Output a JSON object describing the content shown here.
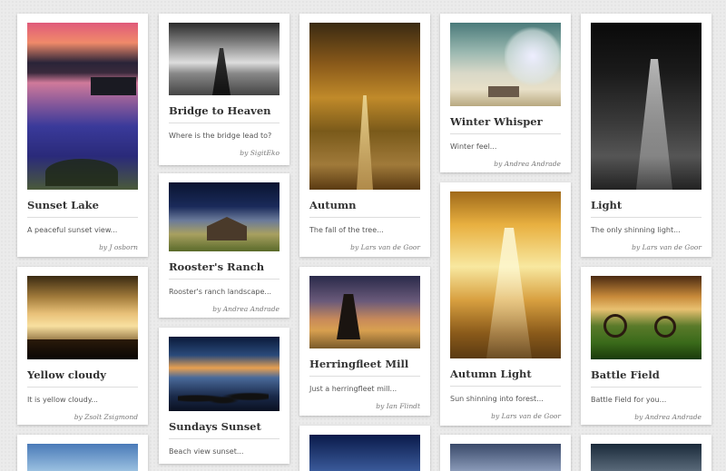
{
  "cards": [
    {
      "title": "Sunset Lake",
      "desc": "A peaceful sunset view...",
      "author": "by J osborn"
    },
    {
      "title": "Bridge to Heaven",
      "desc": "Where is the bridge lead to?",
      "author": "by SigitEko"
    },
    {
      "title": "Autumn",
      "desc": "The fall of the tree...",
      "author": "by Lars van de Goor"
    },
    {
      "title": "Winter Whisper",
      "desc": "Winter feel...",
      "author": "by Andrea Andrade"
    },
    {
      "title": "Light",
      "desc": "The only shinning light...",
      "author": "by Lars van de Goor"
    },
    {
      "title": "Rooster's Ranch",
      "desc": "Rooster's ranch landscape...",
      "author": "by Andrea Andrade"
    },
    {
      "title": "Yellow cloudy",
      "desc": "It is yellow cloudy...",
      "author": "by Zsolt Zsigmond"
    },
    {
      "title": "Herringfleet Mill",
      "desc": "Just a herringfleet mill...",
      "author": "by Ian Flindt"
    },
    {
      "title": "Autumn Light",
      "desc": "Sun shinning into forest...",
      "author": "by Lars van de Goor"
    },
    {
      "title": "Battle Field",
      "desc": "Battle Field for you...",
      "author": "by Andrea Andrade"
    },
    {
      "title": "Sundays Sunset",
      "desc": "Beach view sunset...",
      "author": ""
    }
  ]
}
